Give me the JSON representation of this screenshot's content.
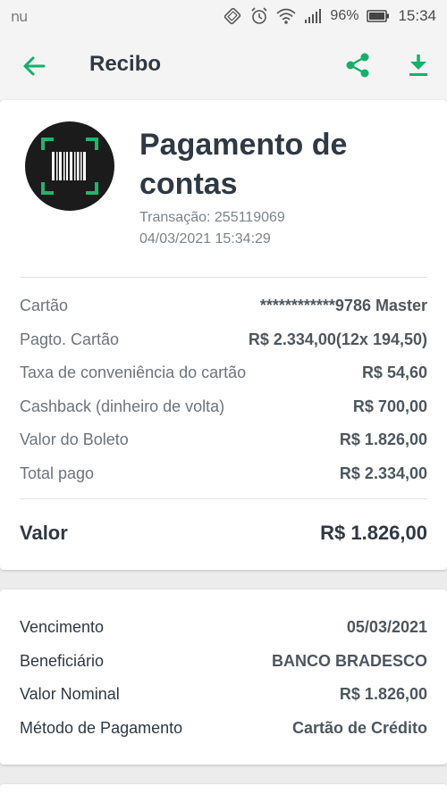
{
  "status_bar": {
    "left_text": "nu",
    "battery_percent": "96%",
    "time": "15:34",
    "icons": [
      "vibrate-icon",
      "alarm-icon",
      "wifi-icon",
      "signal-icon",
      "battery-icon"
    ]
  },
  "app_bar": {
    "title": "Recibo",
    "accent_color": "#13b16a",
    "icons": [
      "back-arrow-icon",
      "share-icon",
      "download-icon"
    ]
  },
  "receipt": {
    "icon": "barcode-icon",
    "title": "Pagamento de contas",
    "transaction": "Transação: 255119069",
    "datetime": "04/03/2021 15:34:29",
    "rows": [
      {
        "label": "Cartão",
        "value": "************9786 Master"
      },
      {
        "label": "Pagto. Cartão",
        "value": "R$ 2.334,00(12x 194,50)"
      },
      {
        "label": "Taxa de conveniência do cartão",
        "value": "R$ 54,60"
      },
      {
        "label": "Cashback (dinheiro de volta)",
        "value": "R$ 700,00"
      },
      {
        "label": "Valor do Boleto",
        "value": "R$ 1.826,00"
      },
      {
        "label": "Total pago",
        "value": "R$ 2.334,00"
      }
    ],
    "total_label": "Valor",
    "total_value": "R$ 1.826,00"
  },
  "details": {
    "rows": [
      {
        "label": "Vencimento",
        "value": "05/03/2021"
      },
      {
        "label": "Beneficiário",
        "value": "BANCO BRADESCO"
      },
      {
        "label": "Valor Nominal",
        "value": "R$ 1.826,00"
      },
      {
        "label": "Método de Pagamento",
        "value": "Cartão de Crédito"
      }
    ]
  }
}
